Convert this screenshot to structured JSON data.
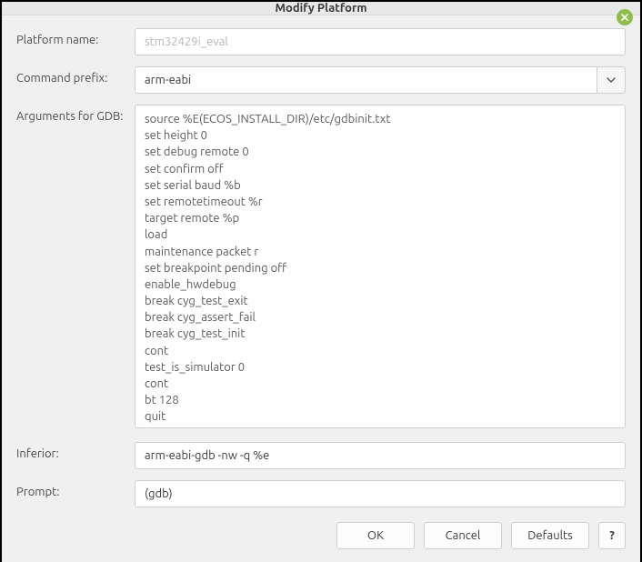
{
  "title": "Modify Platform",
  "labels": {
    "platform_name": "Platform name:",
    "command_prefix": "Command prefix:",
    "arguments_gdb": "Arguments for GDB:",
    "inferior": "Inferior:",
    "prompt": "Prompt:"
  },
  "fields": {
    "platform_name": "stm32429i_eval",
    "command_prefix": "arm-eabi",
    "arguments_gdb": "source %E(ECOS_INSTALL_DIR)/etc/gdbinit.txt\nset height 0\nset debug remote 0\nset confirm off\nset serial baud %b\nset remotetimeout %r\ntarget remote %p\nload\nmaintenance packet r\nset breakpoint pending off\nenable_hwdebug\nbreak cyg_test_exit\nbreak cyg_assert_fail\nbreak cyg_test_init\ncont\ntest_is_simulator 0\ncont\nbt 128\nquit",
    "inferior": "arm-eabi-gdb -nw -q %e",
    "prompt": "(gdb)"
  },
  "buttons": {
    "ok": "OK",
    "cancel": "Cancel",
    "defaults": "Defaults",
    "help": "?"
  }
}
